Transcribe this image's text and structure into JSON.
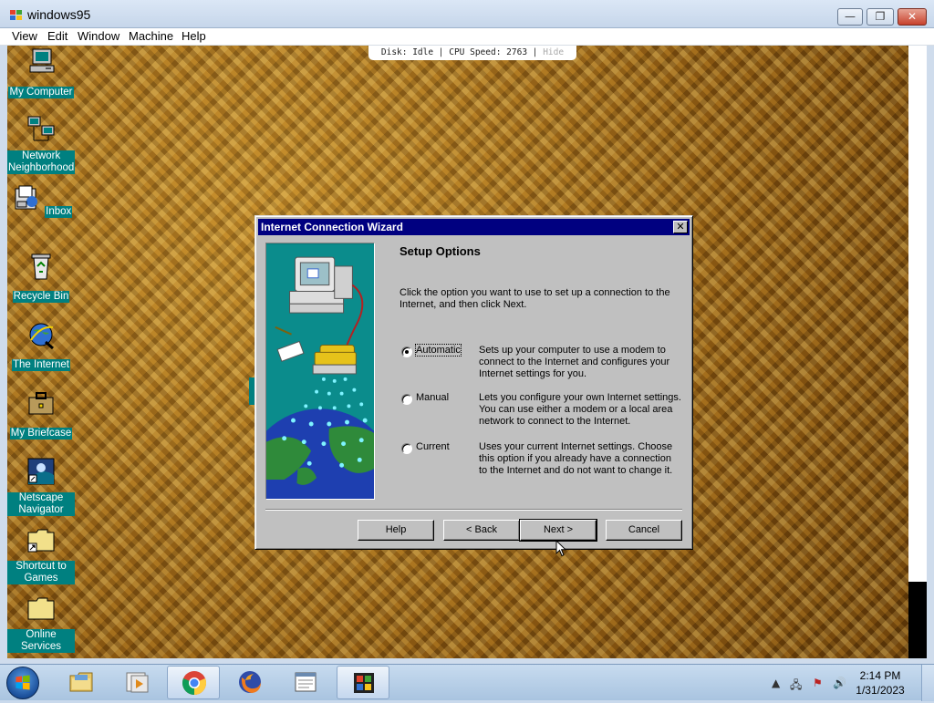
{
  "host": {
    "title": "windows95",
    "menu": [
      "View",
      "Edit",
      "Window",
      "Machine",
      "Help"
    ],
    "controls": {
      "minimize": "—",
      "maximize": "❐",
      "close": "✕"
    }
  },
  "emulator_status": {
    "text": "Disk: Idle | CPU Speed: 2763 | ",
    "hide_label": "Hide"
  },
  "desktop": {
    "icons": [
      {
        "label": "My Computer",
        "icon": "my-computer-icon"
      },
      {
        "label": "Network Neighborhood",
        "icon": "network-neighborhood-icon"
      },
      {
        "label": "Inbox",
        "icon": "inbox-icon"
      },
      {
        "label": "Recycle Bin",
        "icon": "recycle-bin-icon"
      },
      {
        "label": "The Internet",
        "icon": "internet-explorer-icon"
      },
      {
        "label": "My Briefcase",
        "icon": "briefcase-icon"
      },
      {
        "label": "Netscape Navigator",
        "icon": "netscape-icon"
      },
      {
        "label": "Shortcut to Games",
        "icon": "folder-shortcut-icon"
      },
      {
        "label": "Online Services",
        "icon": "folder-icon"
      }
    ]
  },
  "wizard": {
    "title": "Internet Connection Wizard",
    "close": "✕",
    "heading": "Setup Options",
    "intro": "Click the option you want to use to set up a connection to the Internet, and then click Next.",
    "options": [
      {
        "label": "Automatic",
        "description": "Sets up your computer to use a modem to connect to the Internet and configures your Internet settings for you.",
        "selected": true
      },
      {
        "label": "Manual",
        "description": "Lets you configure your own Internet settings.  You can use either a modem or a local area network to connect to the Internet.",
        "selected": false
      },
      {
        "label": "Current",
        "description": "Uses your current Internet settings.  Choose this option if you already have a connection to the Internet and do not want to change it.",
        "selected": false
      }
    ],
    "buttons": {
      "help": "Help",
      "back": "< Back",
      "next": "Next >",
      "cancel": "Cancel"
    }
  },
  "taskbar": {
    "apps": [
      {
        "name": "Windows Explorer",
        "icon": "explorer-icon"
      },
      {
        "name": "Media Player",
        "icon": "media-player-icon"
      },
      {
        "name": "Google Chrome",
        "icon": "chrome-icon"
      },
      {
        "name": "Firefox",
        "icon": "firefox-icon"
      },
      {
        "name": "Notepad",
        "icon": "notepad-icon"
      },
      {
        "name": "windows95",
        "icon": "windows95-icon"
      }
    ],
    "tray": {
      "arrow": "▲",
      "network": "🖧",
      "flag": "⚑",
      "volume": "🔊"
    },
    "clock": {
      "time": "2:14 PM",
      "date": "1/31/2023"
    }
  },
  "colors": {
    "win95_title": "#000080",
    "win95_face": "#c0c0c0",
    "desktop_label_bg": "#008080",
    "host_close": "#c7412d"
  }
}
